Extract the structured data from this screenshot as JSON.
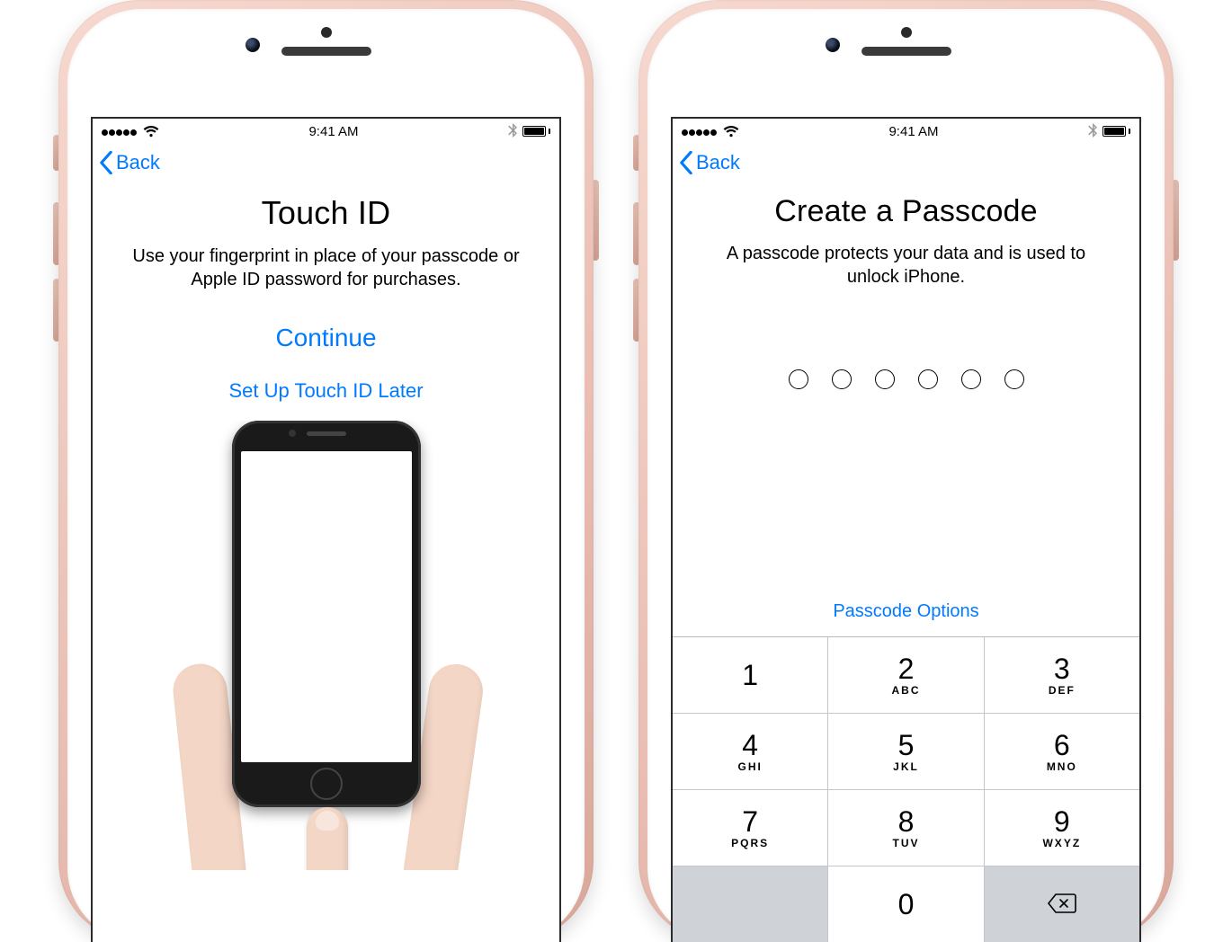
{
  "status": {
    "time": "9:41 AM",
    "carrier_dots": 5,
    "wifi_icon": "wifi-icon",
    "bluetooth_icon": "bluetooth-icon",
    "battery_icon": "battery-icon"
  },
  "nav": {
    "back_label": "Back"
  },
  "left_screen": {
    "title": "Touch ID",
    "subtitle": "Use your fingerprint in place of your passcode or Apple ID password for purchases.",
    "continue_label": "Continue",
    "later_label": "Set Up Touch ID Later"
  },
  "right_screen": {
    "title": "Create a Passcode",
    "subtitle": "A passcode protects your data and is used to unlock iPhone.",
    "passcode_length": 6,
    "options_label": "Passcode Options",
    "keypad": [
      {
        "num": "1",
        "letters": ""
      },
      {
        "num": "2",
        "letters": "ABC"
      },
      {
        "num": "3",
        "letters": "DEF"
      },
      {
        "num": "4",
        "letters": "GHI"
      },
      {
        "num": "5",
        "letters": "JKL"
      },
      {
        "num": "6",
        "letters": "MNO"
      },
      {
        "num": "7",
        "letters": "PQRS"
      },
      {
        "num": "8",
        "letters": "TUV"
      },
      {
        "num": "9",
        "letters": "WXYZ"
      },
      {
        "blank": true
      },
      {
        "num": "0",
        "letters": ""
      },
      {
        "delete": true
      }
    ]
  },
  "colors": {
    "ios_blue": "#007aff"
  }
}
